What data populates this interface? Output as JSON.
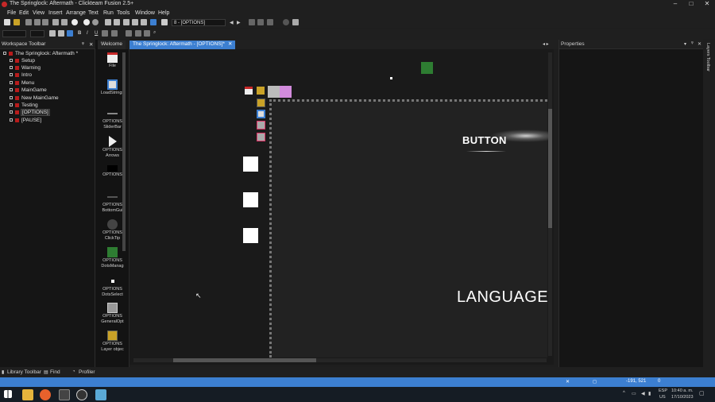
{
  "window": {
    "title": "The Springlock: Aftermath - Clickteam Fusion 2.5+",
    "controls": [
      "–",
      "□",
      "✕"
    ]
  },
  "menu": [
    "File",
    "Edit",
    "View",
    "Insert",
    "Arrange",
    "Text",
    "Run",
    "Tools",
    "Window",
    "Help"
  ],
  "toolbar": {
    "frame_combo": "8 - [OPTIONS]"
  },
  "workspace": {
    "title": "Workspace Toolbar",
    "pin": "ᵠ",
    "close": "✕",
    "root": "The Springlock: Aftermath *",
    "items": [
      {
        "label": "Setup",
        "selected": false
      },
      {
        "label": "Warning",
        "selected": false
      },
      {
        "label": "Intro",
        "selected": false
      },
      {
        "label": "Menu",
        "selected": false
      },
      {
        "label": "MainGame",
        "selected": false
      },
      {
        "label": "New MainGame",
        "selected": false
      },
      {
        "label": "Testing",
        "selected": false
      },
      {
        "label": "[OPTIONS]",
        "selected": true
      },
      {
        "label": "[PAUSE]",
        "selected": false
      }
    ]
  },
  "objects": [
    {
      "name": "File",
      "icon": "file-icon"
    },
    {
      "name": "LoadStrings",
      "icon": "ini-icon"
    },
    {
      "name": "OPTIONS SliderBar",
      "icon": "slider-icon"
    },
    {
      "name": "OPTIONS Arrows",
      "icon": "arrow-icon"
    },
    {
      "name": "OPTIONS",
      "icon": "black-rect-icon"
    },
    {
      "name": "OPTIONS BottomGui",
      "icon": "line-icon"
    },
    {
      "name": "OPTIONS ClickTip",
      "icon": "click-icon"
    },
    {
      "name": "OPTIONS DotsManag",
      "icon": "green-square-icon"
    },
    {
      "name": "OPTIONS DotsSelect",
      "icon": "dot-icon"
    },
    {
      "name": "OPTIONS GeneralOpt",
      "icon": "general-icon"
    },
    {
      "name": "OPTIONS Layer objec",
      "icon": "layer-icon"
    }
  ],
  "tabs": [
    {
      "label": "Welcome",
      "active": false
    },
    {
      "label": "The Springlock: Aftermath - [OPTIONS]*",
      "active": true
    }
  ],
  "frame": {
    "button_text": "BUTTON",
    "language_text": "LANGUAGE"
  },
  "properties": {
    "title": "Properties"
  },
  "right_strip": {
    "label": "Layers Toolbar"
  },
  "bottom_tabs": [
    "Library Toolbar",
    "Find",
    "Profiler"
  ],
  "status": {
    "coords": "-191, 521",
    "count": "0"
  },
  "taskbar": {
    "lang": "ESP",
    "lang2": "US",
    "time": "10:40 a. m.",
    "date": "17/10/2023"
  },
  "colors": {
    "accent": "#3c7fd1",
    "active_tab": "#3c7fd1",
    "green_obj": "#2e7d32"
  }
}
